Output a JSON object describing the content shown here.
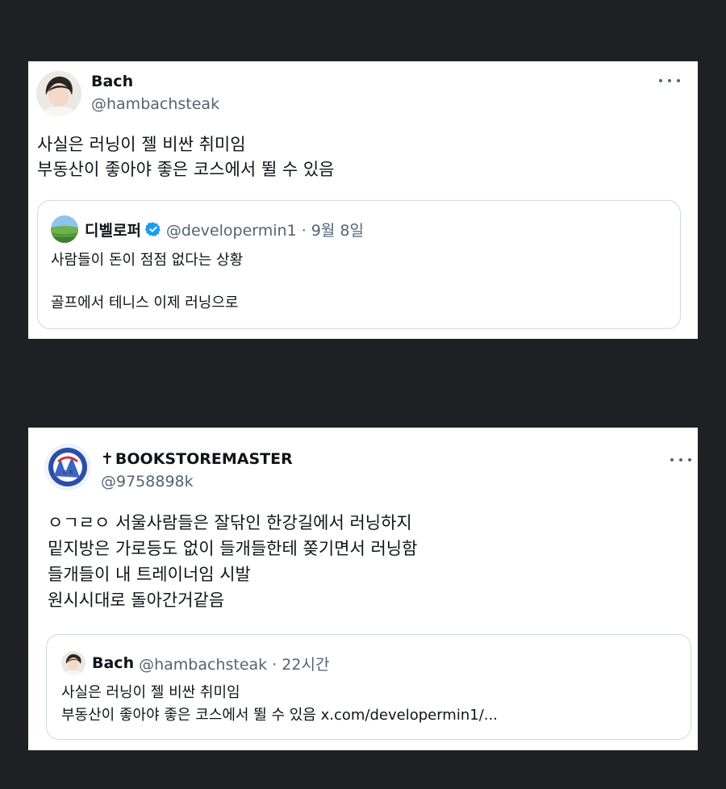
{
  "tweets": [
    {
      "name": "Bach",
      "handle": "@hambachsteak",
      "lines": [
        "사실은 러닝이 젤 비싼 취미임",
        "부동산이 좋아야 좋은 코스에서 뛸 수 있음"
      ],
      "quote": {
        "name": "디벨로퍼",
        "verified": true,
        "meta": "@developermin1 · 9월 8일",
        "lines": [
          "사람들이 돈이 점점 없다는 상황",
          "골프에서 테니스 이제 러닝으로"
        ]
      }
    },
    {
      "name_prefix": "✝",
      "name": "BOOKSTOREMASTER",
      "handle": "@9758898k",
      "lines": [
        "ㅇㄱㄹㅇ 서울사람들은 잘닦인 한강길에서 러닝하지",
        "밑지방은 가로등도 없이 들개들한테 쫒기면서 러닝함",
        "들개들이 내 트레이너임 시발",
        "원시시대로 돌아간거같음"
      ],
      "quote": {
        "name": "Bach",
        "meta": "@hambachsteak · 22시간",
        "lines": [
          "사실은 러닝이 젤 비싼 취미임",
          "부동산이 좋아야 좋은 코스에서 뛸 수 있음"
        ],
        "link": "x.com/developermin1/..."
      }
    }
  ],
  "icons": {
    "more": "more-horizontal-icon",
    "verified": "verified-badge-icon"
  },
  "colors": {
    "background": "#1f2024",
    "card": "#ffffff",
    "secondary_text": "#536471",
    "verified": "#1d9bf0",
    "border": "#cfd9de"
  }
}
